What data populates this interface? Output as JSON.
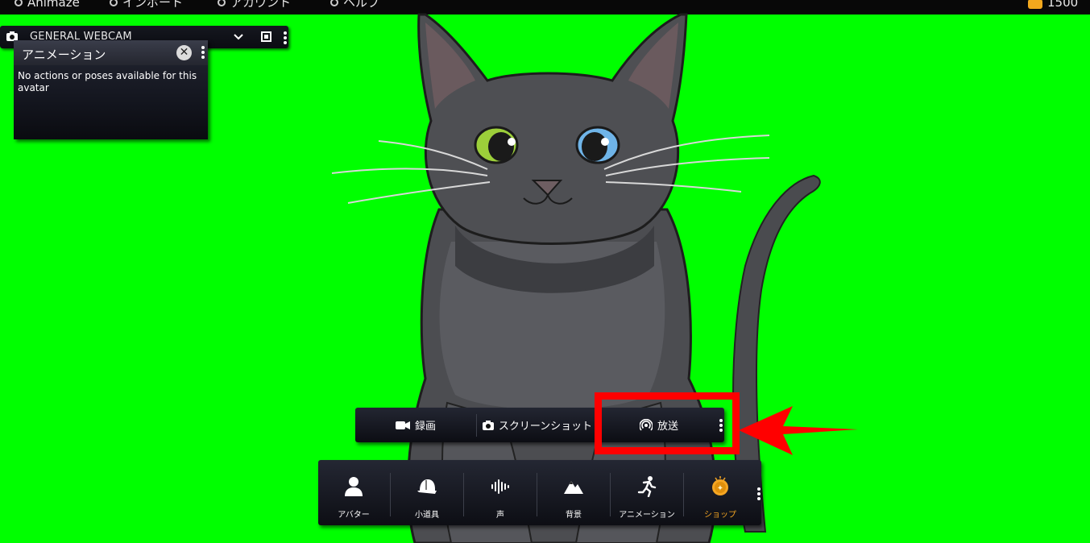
{
  "topbar": {
    "app_name": "Animaze",
    "menu_import": "インポート",
    "menu_account": "アカウント",
    "menu_help": "ヘルプ",
    "coins": "1500"
  },
  "webcam": {
    "device_name": "GENERAL WEBCAM"
  },
  "animation_panel": {
    "title": "アニメーション",
    "message": "No actions or poses available for this avatar"
  },
  "action_bar": {
    "record_label": "録画",
    "screenshot_label": "スクリーンショット",
    "broadcast_label": "放送"
  },
  "dock": {
    "items": [
      {
        "label": "アバター",
        "icon": "person-icon"
      },
      {
        "label": "小道具",
        "icon": "cap-icon"
      },
      {
        "label": "声",
        "icon": "soundwave-icon"
      },
      {
        "label": "背景",
        "icon": "mountains-icon"
      },
      {
        "label": "アニメーション",
        "icon": "running-icon"
      },
      {
        "label": "ショップ",
        "icon": "coin-icon"
      }
    ],
    "active_item": "ショップ"
  },
  "colors": {
    "background": "#00ff00",
    "highlight": "#ff0000",
    "shop_accent": "#f5a623"
  }
}
